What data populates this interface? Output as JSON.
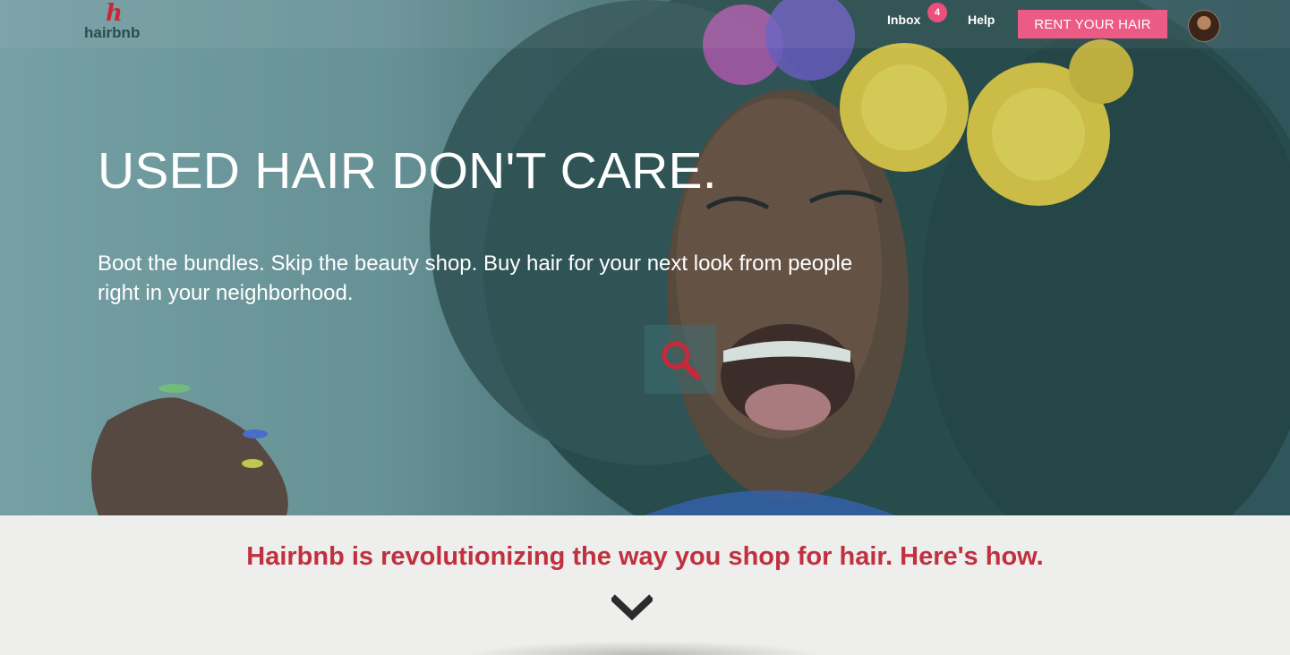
{
  "nav": {
    "logo_mark": "h",
    "logo_text": "hairbnb",
    "inbox_label": "Inbox",
    "inbox_count": "4",
    "help_label": "Help",
    "rent_button_label": "RENT YOUR HAIR"
  },
  "hero": {
    "headline": "USED HAIR DON'T CARE.",
    "subtext": "Boot the bundles. Skip the beauty shop. Buy hair for your next look from people right in your neighborhood."
  },
  "section": {
    "tagline": "Hairbnb is revolutionizing the way you shop for hair. Here's how."
  },
  "icons": {
    "search": "search-icon",
    "scroll": "chevron-down-icon",
    "avatar": "avatar"
  },
  "colors": {
    "brand_red": "#c0303f",
    "button_pink": "#ec5a86",
    "badge_pink": "#ec4e7e",
    "hero_teal": "#4d777b",
    "section_bg": "#eeeeec"
  }
}
